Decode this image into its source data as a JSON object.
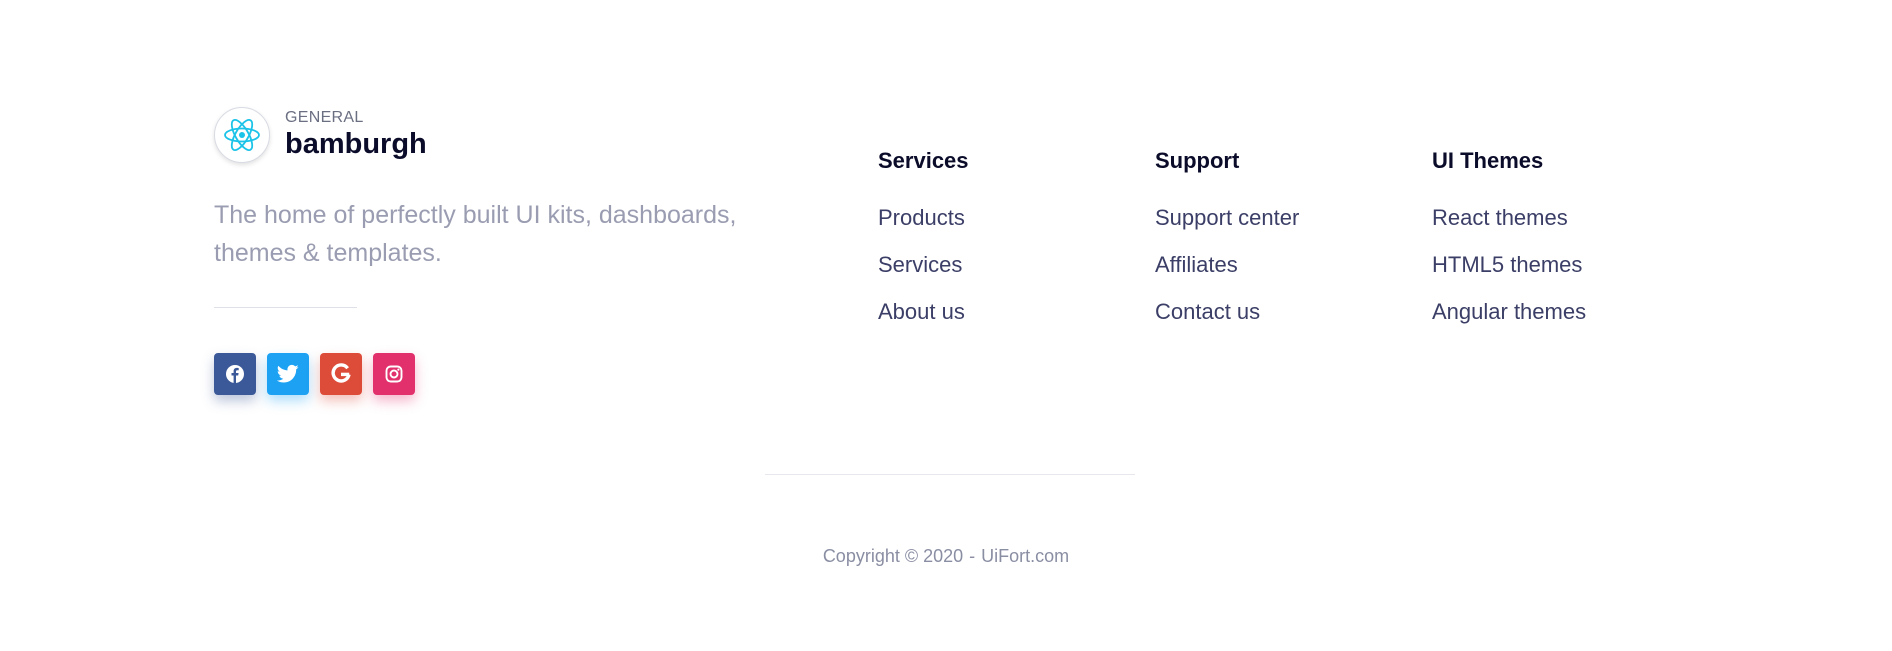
{
  "brand": {
    "small_label": "GENERAL",
    "name": "bamburgh",
    "logo_icon": "react-atom-icon",
    "logo_color": "#1bc3e8"
  },
  "tagline": "The home of perfectly built UI kits, dashboards, themes & templates.",
  "social": [
    {
      "icon": "facebook-icon",
      "color": "#3b5998"
    },
    {
      "icon": "twitter-icon",
      "color": "#1da1f2"
    },
    {
      "icon": "google-icon",
      "color": "#dd4b39"
    },
    {
      "icon": "instagram-icon",
      "color": "#e1306c"
    }
  ],
  "columns": [
    {
      "heading": "Services",
      "links": [
        "Products",
        "Services",
        "About us"
      ]
    },
    {
      "heading": "Support",
      "links": [
        "Support center",
        "Affiliates",
        "Contact us"
      ]
    },
    {
      "heading": "UI Themes",
      "links": [
        "React themes",
        "HTML5 themes",
        "Angular themes"
      ]
    }
  ],
  "copyright": {
    "text": "Copyright © 2020",
    "separator": "-",
    "site": "UiFort.com"
  }
}
